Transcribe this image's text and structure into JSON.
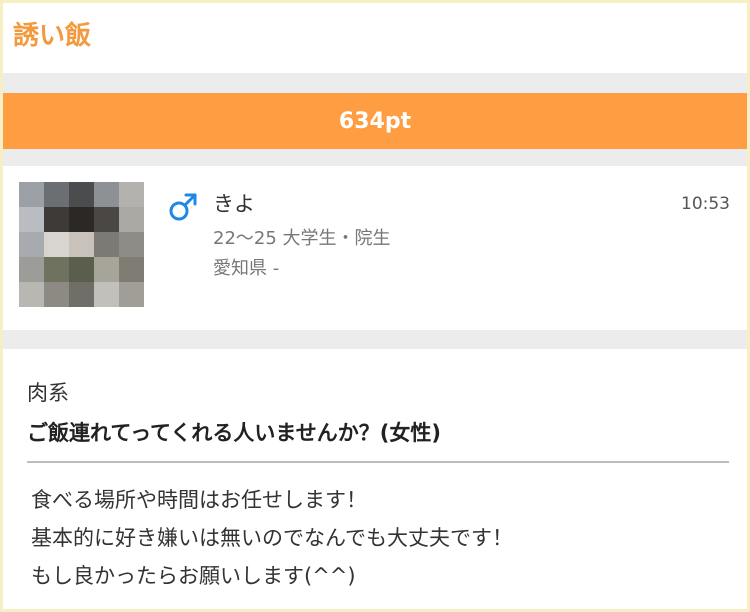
{
  "header": {
    "title": "誘い飯"
  },
  "points": {
    "label": "634pt"
  },
  "profile": {
    "name": "きよ",
    "gender_icon": "male-symbol-icon",
    "age_occupation": "22〜25 大学生・院生",
    "location": "愛知県 -",
    "time": "10:53",
    "gender_color": "#1e88e5"
  },
  "post": {
    "category": "肉系",
    "title": "ご飯連れてってくれる人いませんか？(女性)",
    "body": [
      "食べる場所や時間はお任せします！",
      "基本的に好き嫌いは無いのでなんでも大丈夫です！",
      "もし良かったらお願いします(^^)"
    ]
  },
  "colors": {
    "accent": "#ff9d42",
    "title": "#f39a3f",
    "border": "#f7efc4"
  }
}
